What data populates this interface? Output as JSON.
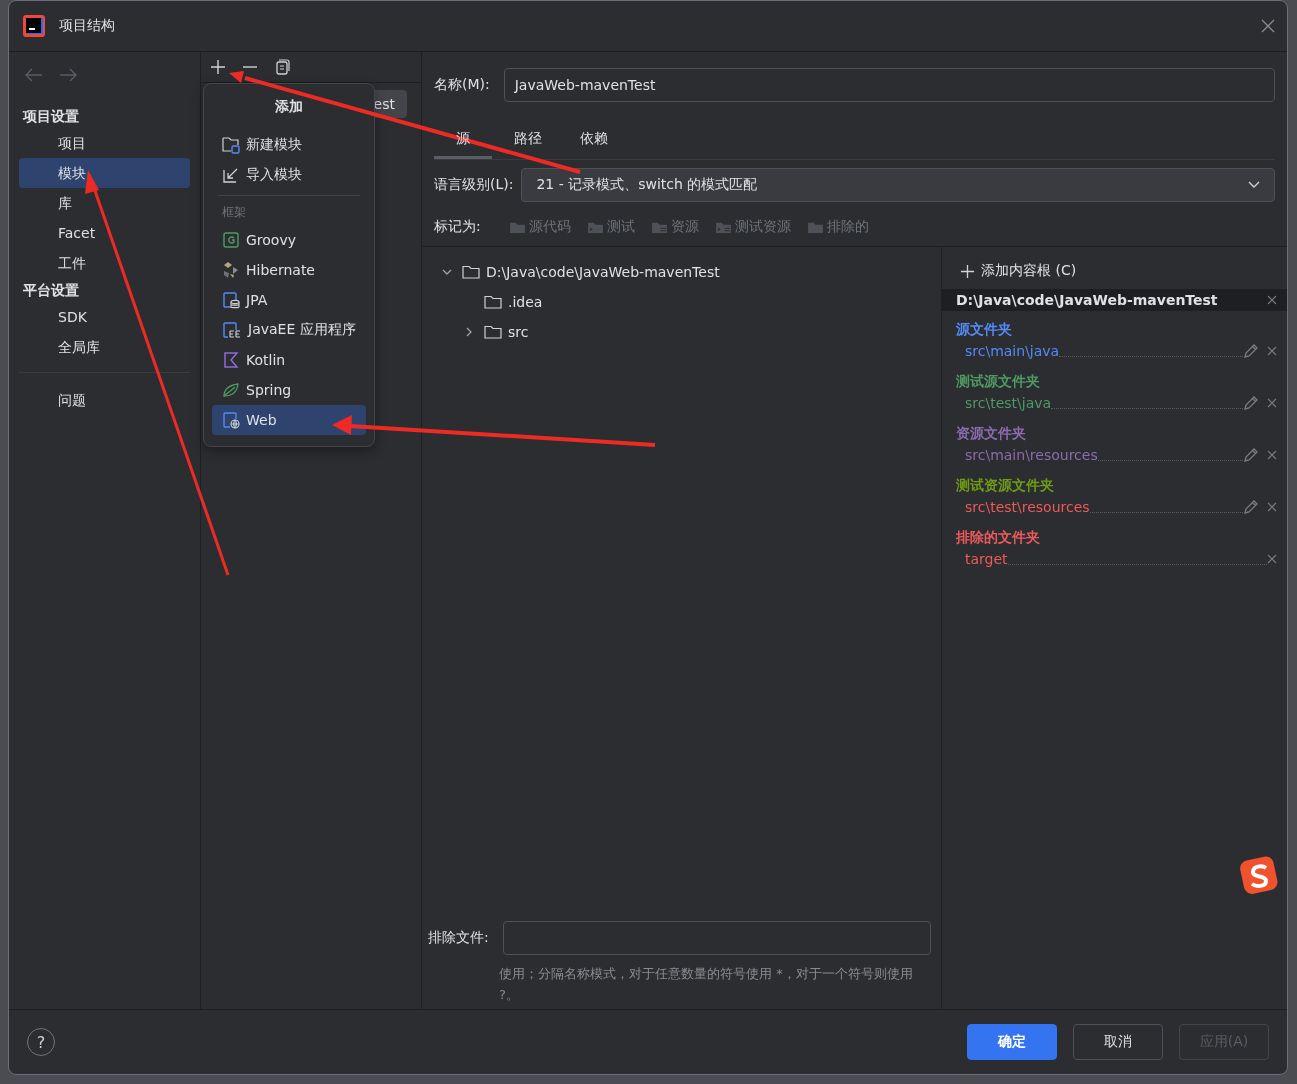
{
  "window": {
    "title": "项目结构"
  },
  "sidebar": {
    "sections": [
      {
        "heading": "项目设置",
        "items": [
          {
            "label": "项目",
            "selected": false
          },
          {
            "label": "模块",
            "selected": true
          },
          {
            "label": "库",
            "selected": false
          },
          {
            "label": "Facet",
            "selected": false
          },
          {
            "label": "工件",
            "selected": false
          }
        ]
      },
      {
        "heading": "平台设置",
        "items": [
          {
            "label": "SDK",
            "selected": false
          },
          {
            "label": "全局库",
            "selected": false
          }
        ]
      }
    ],
    "problems": "问题"
  },
  "module_list": {
    "items": [
      {
        "label": "est",
        "selected": true
      }
    ]
  },
  "add_menu": {
    "title": "添加",
    "actions": [
      {
        "kind": "new",
        "label": "新建模块"
      },
      {
        "kind": "import",
        "label": "导入模块"
      }
    ],
    "section_label": "框架",
    "frameworks": [
      {
        "kind": "groovy",
        "label": "Groovy",
        "selected": false
      },
      {
        "kind": "hibernate",
        "label": "Hibernate",
        "selected": false
      },
      {
        "kind": "jpa",
        "label": "JPA",
        "selected": false
      },
      {
        "kind": "javaee",
        "label": "JavaEE 应用程序",
        "selected": false
      },
      {
        "kind": "kotlin",
        "label": "Kotlin",
        "selected": false
      },
      {
        "kind": "spring",
        "label": "Spring",
        "selected": false
      },
      {
        "kind": "web",
        "label": "Web",
        "selected": true
      }
    ]
  },
  "module": {
    "name_label": "名称(M):",
    "name": "JavaWeb-mavenTest",
    "tabs": [
      {
        "label": "源",
        "selected": true
      },
      {
        "label": "路径",
        "selected": false
      },
      {
        "label": "依赖",
        "selected": false
      }
    ],
    "language_label": "语言级别(L):",
    "language_level": "21 - 记录模式、switch 的模式匹配",
    "mark_label": "标记为:",
    "mark_buttons": [
      {
        "kind": "source",
        "label": "源代码"
      },
      {
        "kind": "test",
        "label": "测试"
      },
      {
        "kind": "resource",
        "label": "资源"
      },
      {
        "kind": "test_resource",
        "label": "测试资源"
      },
      {
        "kind": "excluded",
        "label": "排除的"
      }
    ],
    "tree": [
      {
        "label": "D:\\Java\\code\\JavaWeb-mavenTest",
        "expanded": true,
        "children": [
          {
            "label": ".idea"
          },
          {
            "label": "src",
            "expanded": false
          }
        ]
      }
    ],
    "exclude_label": "排除文件:",
    "exclude_hint": "使用；分隔名称模式，对于任意数量的符号使用 *，对于一个符号则使用 ?。"
  },
  "content_root": {
    "add_label": "添加内容根 (C)",
    "path": "D:\\Java\\code\\JavaWeb-mavenTest",
    "groups": [
      {
        "heading": "源文件夹",
        "color": "#548af7",
        "paths": [
          {
            "path": "src\\main\\java",
            "color": "#548af7",
            "editable": true
          }
        ]
      },
      {
        "heading": "测试源文件夹",
        "color": "#4f9a63",
        "paths": [
          {
            "path": "src\\test\\java",
            "color": "#4f9a63",
            "editable": true
          }
        ]
      },
      {
        "heading": "资源文件夹",
        "color": "#8c6bb1",
        "paths": [
          {
            "path": "src\\main\\resources",
            "color": "#8c6bb1",
            "editable": true
          }
        ]
      },
      {
        "heading": "测试资源文件夹",
        "color": "#6f9b16",
        "paths": [
          {
            "path": "src\\test\\resources",
            "color": "#ec5a5a",
            "editable": true
          }
        ]
      },
      {
        "heading": "排除的文件夹",
        "color": "#ec5a5a",
        "paths": [
          {
            "path": "target",
            "color": "#ec5a5a",
            "editable": false
          }
        ]
      }
    ]
  },
  "footer": {
    "help": "?",
    "buttons": [
      {
        "kind": "primary",
        "label": "确定",
        "disabled": false
      },
      {
        "kind": "secondary",
        "label": "取消",
        "disabled": false
      },
      {
        "kind": "secondary",
        "label": "应用(A)",
        "disabled": true
      }
    ]
  }
}
